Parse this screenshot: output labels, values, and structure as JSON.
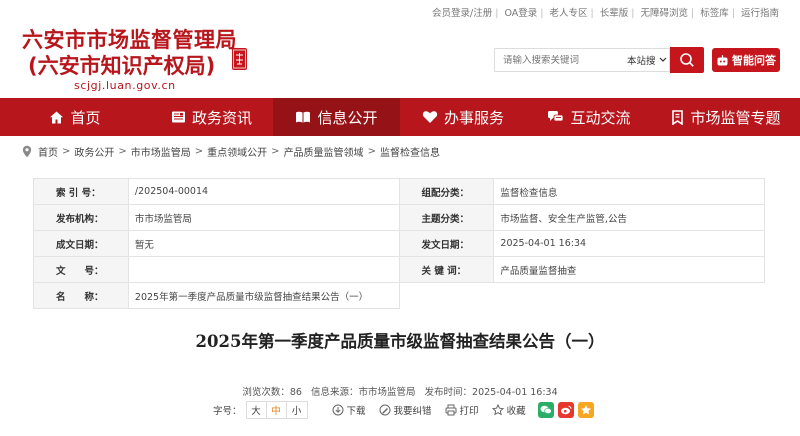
{
  "header": {
    "top_links": [
      "会员登录/注册",
      "OA登录",
      "老人专区",
      "长辈版",
      "无障碍浏览",
      "标签库",
      "运行指南"
    ],
    "org_name": "六安市市场监督管理局",
    "org_name_alt": "(六安市知识产权局)",
    "domain": "scjgj.luan.gov.cn",
    "search_placeholder": "请输入搜索关键词",
    "search_scope": "本站搜",
    "qa_label": "智能问答"
  },
  "nav": {
    "items": [
      {
        "label": "首页",
        "icon": "home-icon"
      },
      {
        "label": "政务资讯",
        "icon": "news-icon"
      },
      {
        "label": "信息公开",
        "icon": "book-icon"
      },
      {
        "label": "办事服务",
        "icon": "heart-icon"
      },
      {
        "label": "互动交流",
        "icon": "chat-icon"
      },
      {
        "label": "市场监管专题",
        "icon": "bookmark-icon"
      }
    ],
    "active": "信息公开"
  },
  "breadcrumb": [
    "首页",
    "政务公开",
    "市市场监管局",
    "重点领域公开",
    "产品质量监管领域",
    "监督检查信息"
  ],
  "info": {
    "index_label": "索 引 号：",
    "index_value": "/202504-00014",
    "category_label": "组配分类：",
    "category_value": "监督检查信息",
    "publisher_label": "发布机构：",
    "publisher_value": "市市场监管局",
    "topic_label": "主题分类：",
    "topic_value": "市场监督、安全生产监管,公告",
    "created_label": "成文日期：",
    "created_value": "暂无",
    "published_label": "发文日期：",
    "published_value": "2025-04-01 16:34",
    "docno_label": "文　　号：",
    "docno_value": "",
    "keywords_label": "关 键 词：",
    "keywords_value": "产品质量监督抽查",
    "name_label": "名　　称：",
    "name_value": "2025年第一季度产品质量市级监督抽查结果公告（一）"
  },
  "article": {
    "title": "2025年第一季度产品质量市级监督抽查结果公告（一）",
    "views": "浏览次数：86",
    "source": "信息来源：市市场监管局",
    "time": "发布时间：2025-04-01 16:34"
  },
  "toolbar": {
    "font_label": "字号：",
    "font_large": "大",
    "font_medium": "中",
    "font_small": "小",
    "download": "下载",
    "correct": "我要纠错",
    "print": "打印",
    "favorite": "收藏"
  },
  "colors": {
    "brand": "#b7161c",
    "nav_active": "#951217",
    "accent_font": "#e8811e"
  }
}
